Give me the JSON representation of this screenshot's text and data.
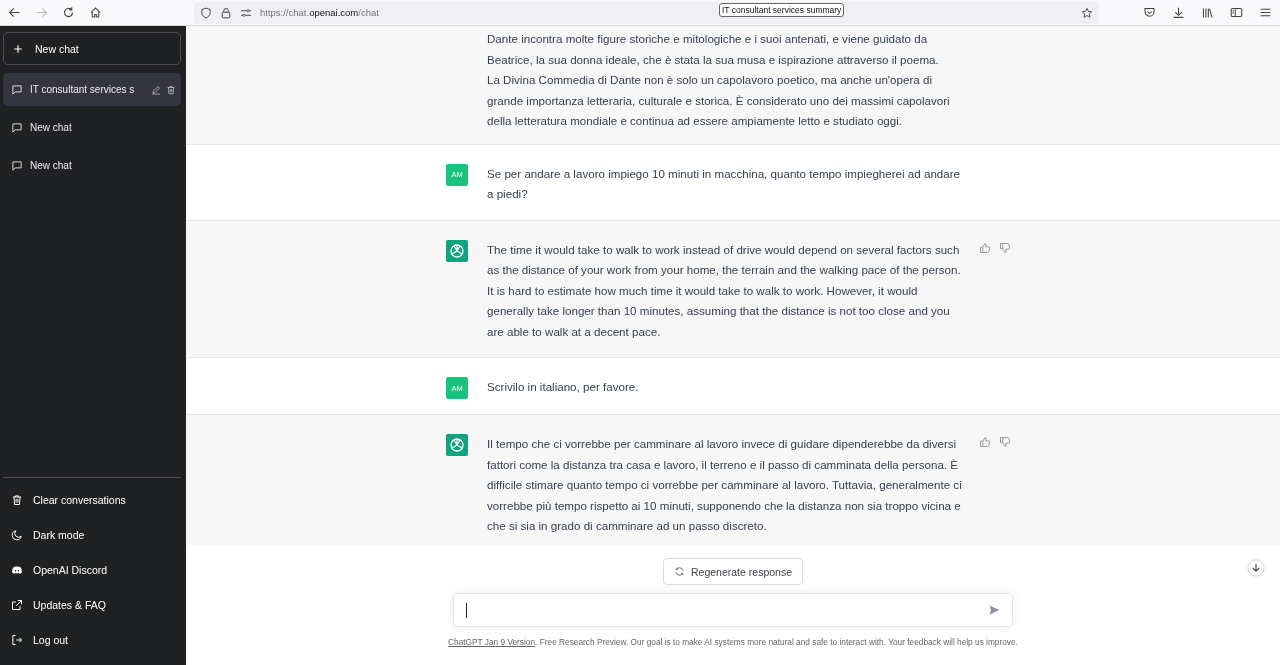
{
  "browser": {
    "url": {
      "prefix": "https://chat.",
      "domain": "openai.com",
      "path": "/chat"
    },
    "tooltip": "IT consultant services summary"
  },
  "sidebar": {
    "new_chat": "New chat",
    "conversations": [
      {
        "title": "IT consultant services s",
        "selected": true
      },
      {
        "title": "New chat",
        "selected": false
      },
      {
        "title": "New chat",
        "selected": false
      }
    ],
    "footer": [
      {
        "kind": "trash",
        "label": "Clear conversations"
      },
      {
        "kind": "moon",
        "label": "Dark mode"
      },
      {
        "kind": "discord",
        "label": "OpenAI Discord"
      },
      {
        "kind": "external",
        "label": "Updates & FAQ"
      },
      {
        "kind": "logout",
        "label": "Log out"
      }
    ]
  },
  "messages": [
    {
      "kind": "assistant",
      "paragraphs": [
        "Dante incontra molte figure storiche e mitologiche e i suoi antenati, e viene guidato da Beatrice, la sua donna ideale, che è stata la sua musa e ispirazione attraverso il poema.",
        "La Divina Commedia di Dante non è solo un capolavoro poetico, ma anche un'opera di grande importanza letteraria, culturale e storica. È considerato uno dei massimi capolavori della letteratura mondiale e continua ad essere ampiamente letto e studiato oggi."
      ],
      "clipped": true
    },
    {
      "kind": "user",
      "avatar": "AM",
      "paragraphs": [
        "Se per andare a lavoro impiego 10 minuti in macchina, quanto tempo impiegherei ad andare a piedi?"
      ]
    },
    {
      "kind": "assistant",
      "paragraphs": [
        "The time it would take to walk to work instead of drive would depend on several factors such as the distance of your work from your home, the terrain and the walking pace of the person. It is hard to estimate how much time it would take to walk to work. However, it would generally take longer than 10 minutes, assuming that the distance is not too close and you are able to walk at a decent pace."
      ]
    },
    {
      "kind": "user",
      "avatar": "AM",
      "paragraphs": [
        "Scrivilo in italiano, per favore."
      ]
    },
    {
      "kind": "assistant",
      "paragraphs": [
        "Il tempo che ci vorrebbe per camminare al lavoro invece di guidare dipenderebbe da diversi fattori come la distanza tra casa e lavoro, il terreno e il passo di camminata della persona. È difficile stimare quanto tempo ci vorrebbe per camminare al lavoro. Tuttavia, generalmente ci vorrebbe più tempo rispetto ai 10 minuti, supponendo che la distanza non sia troppo vicina e che si sia in grado di camminare ad un passo discreto."
      ]
    }
  ],
  "regenerate": "Regenerate response",
  "footer_note": {
    "link": "ChatGPT Jan 9 Version",
    "text": ". Free Research Preview. Our goal is to make AI systems more natural and safe to interact with. Your feedback will help us improve."
  }
}
